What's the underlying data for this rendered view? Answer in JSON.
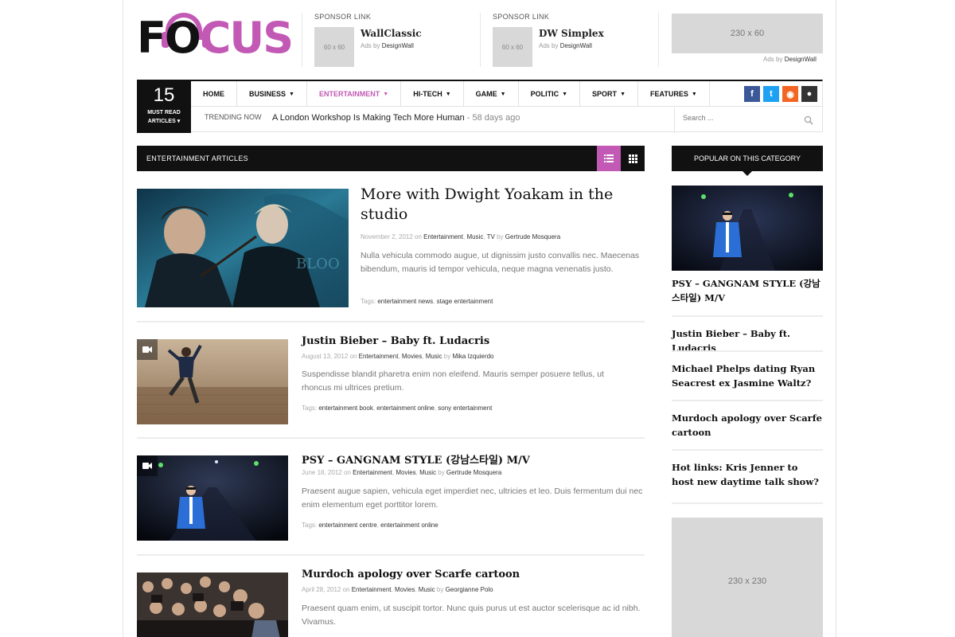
{
  "logo": {
    "text_dark_1": "F",
    "text_dark_2": "O",
    "text_pink": "CUS"
  },
  "sponsors": [
    {
      "label": "SPONSOR LINK",
      "thumb": "60 x 60",
      "title": "WallClassic",
      "sub_prefix": "Ads by ",
      "sub_brand": "DesignWall"
    },
    {
      "label": "SPONSOR LINK",
      "thumb": "60 x 60",
      "title": "DW Simplex",
      "sub_prefix": "Ads by ",
      "sub_brand": "DesignWall"
    }
  ],
  "ad_top": {
    "size": "230 x 60",
    "credit_prefix": "Ads by ",
    "credit_brand": "DesignWall"
  },
  "must_read": {
    "count": "15",
    "label_1": "MUST READ",
    "label_2": "ARTICLES"
  },
  "menu": [
    {
      "label": "HOME",
      "caret": false
    },
    {
      "label": "BUSINESS",
      "caret": true
    },
    {
      "label": "ENTERTAINMENT",
      "caret": true,
      "active": true
    },
    {
      "label": "HI-TECH",
      "caret": true
    },
    {
      "label": "GAME",
      "caret": true
    },
    {
      "label": "POLITIC",
      "caret": true
    },
    {
      "label": "SPORT",
      "caret": true
    },
    {
      "label": "FEATURES",
      "caret": true
    }
  ],
  "socials": [
    {
      "icon": "facebook-icon",
      "glyph": "f",
      "color": "#3b5998"
    },
    {
      "icon": "twitter-icon",
      "glyph": "t",
      "color": "#1da1f2"
    },
    {
      "icon": "rss-icon",
      "glyph": "◉",
      "color": "#f26522"
    },
    {
      "icon": "user-icon",
      "glyph": "●",
      "color": "#333333"
    }
  ],
  "trending": {
    "label": "TRENDING NOW",
    "headline": "A London Workshop Is Making Tech More Human",
    "age": " - 58 days ago"
  },
  "search": {
    "placeholder": "Search ..."
  },
  "section": {
    "title": "ENTERTAINMENT ARTICLES"
  },
  "featured": {
    "title": "More with Dwight Yoakam in the studio",
    "date": "November 2, 2012",
    "on": " on ",
    "cats": [
      "Entertainment",
      "Music",
      "TV"
    ],
    "by": " by ",
    "author": "Gertrude Mosquera",
    "excerpt": "Nulla vehicula commodo augue, ut dignissim justo convallis nec. Maecenas bibendum, mauris id tempor vehicula, neque magna venenatis justo.",
    "tags_label": "Tags: ",
    "tags": [
      "entertainment news",
      "stage entertainment"
    ]
  },
  "articles": [
    {
      "title": "Justin Bieber – Baby ft. Ludacris",
      "date": "August 13, 2012",
      "cats": [
        "Entertainment",
        "Movies",
        "Music"
      ],
      "author": "Mika Izquierdo",
      "excerpt": "Suspendisse blandit pharetra enim non eleifend. Mauris semper posuere tellus, ut rhoncus mi ultrices pretium.",
      "tags": [
        "entertainment book",
        "entertainment online",
        "sony entertainment"
      ]
    },
    {
      "title": "PSY – GANGNAM STYLE (강남스타일) M/V",
      "date": "June 18, 2012",
      "cats": [
        "Entertainment",
        "Movies",
        "Music"
      ],
      "author": "Gertrude Mosquera",
      "excerpt": "Praesent augue sapien, vehicula eget imperdiet nec, ultricies et leo. Duis fermentum dui nec enim elementum eget porttitor lorem.",
      "tags": [
        "entertainment centre",
        "entertainment online"
      ]
    },
    {
      "title": "Murdoch apology over Scarfe cartoon",
      "date": "April 28, 2012",
      "cats": [
        "Entertainment",
        "Movies",
        "Music"
      ],
      "author": "Georgianne Polo",
      "excerpt": "Praesent quam enim, ut suscipit tortor. Nunc quis purus ut est auctor scelerisque ac id nibh. Vivamus."
    }
  ],
  "sidebar": {
    "title": "POPULAR ON THIS CATEGORY",
    "links": [
      "PSY – GANGNAM STYLE (강남스타일) M/V",
      "Justin Bieber – Baby ft. Ludacris",
      "Michael Phelps dating Ryan Seacrest ex Jasmine Waltz?",
      "Murdoch apology over Scarfe cartoon",
      "Hot links: Kris Jenner to host new daytime talk show?"
    ],
    "ad": "230 x 230"
  },
  "colors": {
    "accent": "#c259b5",
    "dark": "#111111"
  }
}
